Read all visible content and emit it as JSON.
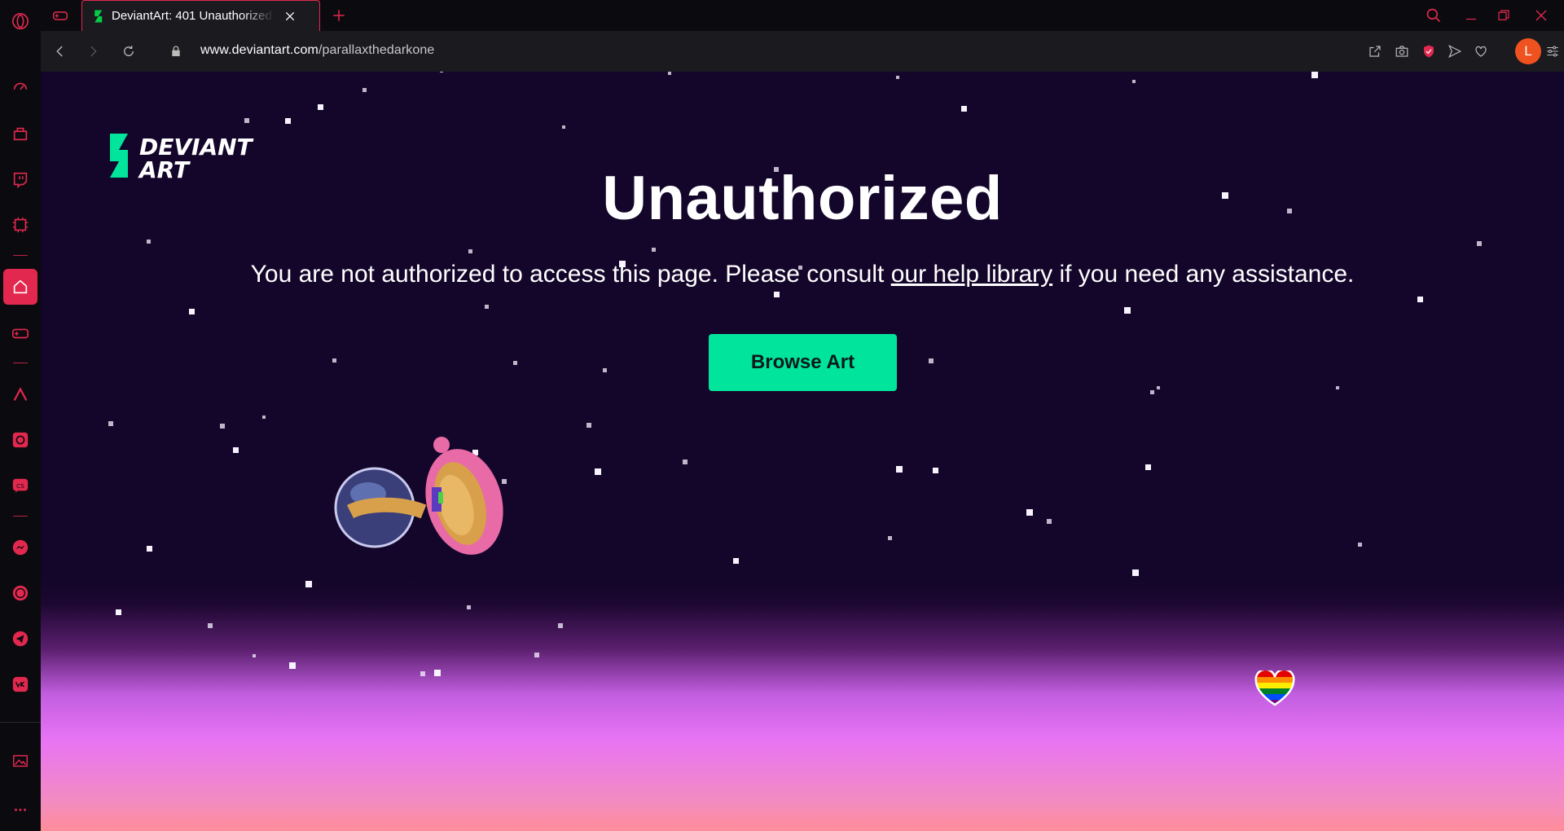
{
  "browser": {
    "tab": {
      "title": "DeviantArt: 401 Unauthorized"
    },
    "address": {
      "host": "www.deviantart.com",
      "path": "/parallaxthedarkone"
    },
    "profile_initial": "L",
    "accent": "#e3284f"
  },
  "sidebar": {
    "items": [
      {
        "name": "opera-logo-icon"
      },
      {
        "name": "speed-dial-icon"
      },
      {
        "name": "store-icon"
      },
      {
        "name": "twitch-icon"
      },
      {
        "name": "gx-control-icon"
      },
      {
        "name": "home-icon"
      },
      {
        "name": "games-icon"
      },
      {
        "name": "aria-icon"
      },
      {
        "name": "chatgpt-icon"
      },
      {
        "name": "chatsonic-icon"
      },
      {
        "name": "messenger-icon"
      },
      {
        "name": "whatsapp-icon"
      },
      {
        "name": "telegram-icon"
      },
      {
        "name": "vk-icon"
      },
      {
        "name": "wallpaper-icon"
      },
      {
        "name": "more-icon"
      }
    ]
  },
  "page": {
    "logo_text_1": "DEVIANT",
    "logo_text_2": "ART",
    "headline": "Unauthorized",
    "message_before": "You are not authorized to access this page. Please consult ",
    "message_link": "our help library",
    "message_after": " if you need any assistance.",
    "button_label": "Browse Art",
    "button_color": "#00e59b",
    "background_color": "#14062a"
  }
}
